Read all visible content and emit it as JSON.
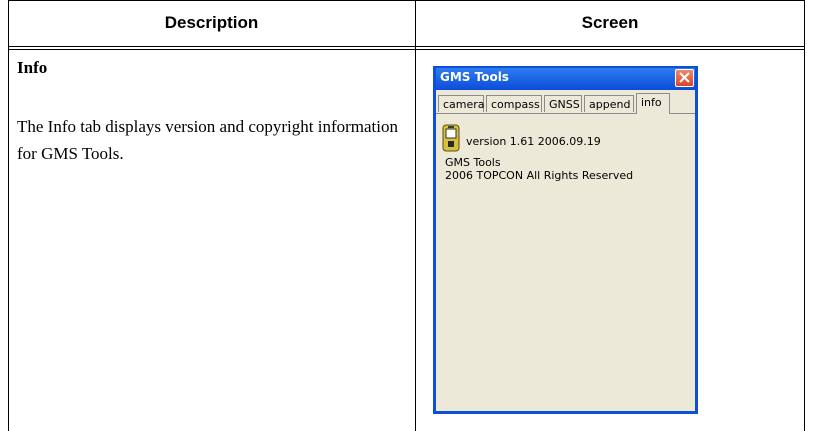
{
  "table": {
    "headers": [
      "Description",
      "Screen"
    ]
  },
  "description": {
    "heading": "Info",
    "text": "The Info tab displays version and copyright information for GMS Tools."
  },
  "window": {
    "title": "GMS Tools",
    "tabs": [
      "camera",
      "compass",
      "GNSS",
      "append",
      "info"
    ],
    "active_tab": "info",
    "version_text": "version 1.61 2006.09.19",
    "app_name": "GMS Tools",
    "copyright": "2006 TOPCON All Rights Reserved",
    "icons": {
      "close": "close-icon",
      "app": "gms-device-icon"
    },
    "colors": {
      "titlebar": "#0b4cd9",
      "client": "#ece9d8",
      "close": "#d9442a"
    }
  }
}
